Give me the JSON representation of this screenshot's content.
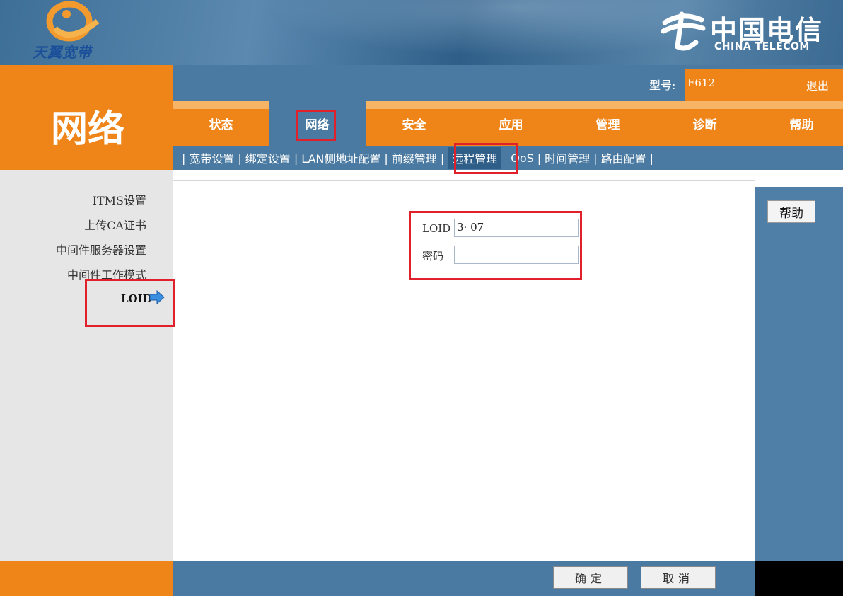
{
  "header": {
    "brand_left": "天翼宽带",
    "brand_right_cn": "中国电信",
    "brand_right_en": "CHINA TELECOM"
  },
  "page_title": "网络",
  "topbar": {
    "model_label": "型号:",
    "model_value": "F612",
    "logout_label": "退出"
  },
  "tabs": [
    "状态",
    "网络",
    "安全",
    "应用",
    "管理",
    "诊断",
    "帮助"
  ],
  "subnav": [
    "宽带设置",
    "绑定设置",
    "LAN侧地址配置",
    "前缀管理",
    "远程管理",
    "QoS",
    "时间管理",
    "路由配置"
  ],
  "sidebar": [
    "ITMS设置",
    "上传CA证书",
    "中间件服务器设置",
    "中间件工作模式",
    "LOID"
  ],
  "form": {
    "loid_label": "LOID",
    "loid_value": "3·      07",
    "password_label": "密码",
    "password_value": ""
  },
  "help_button": "帮助",
  "footer": {
    "confirm_label": "确定",
    "cancel_label": "取消"
  },
  "colors": {
    "orange": "#ef8418",
    "blue": "#4a7aa1",
    "highlight_red": "#e0202a"
  }
}
